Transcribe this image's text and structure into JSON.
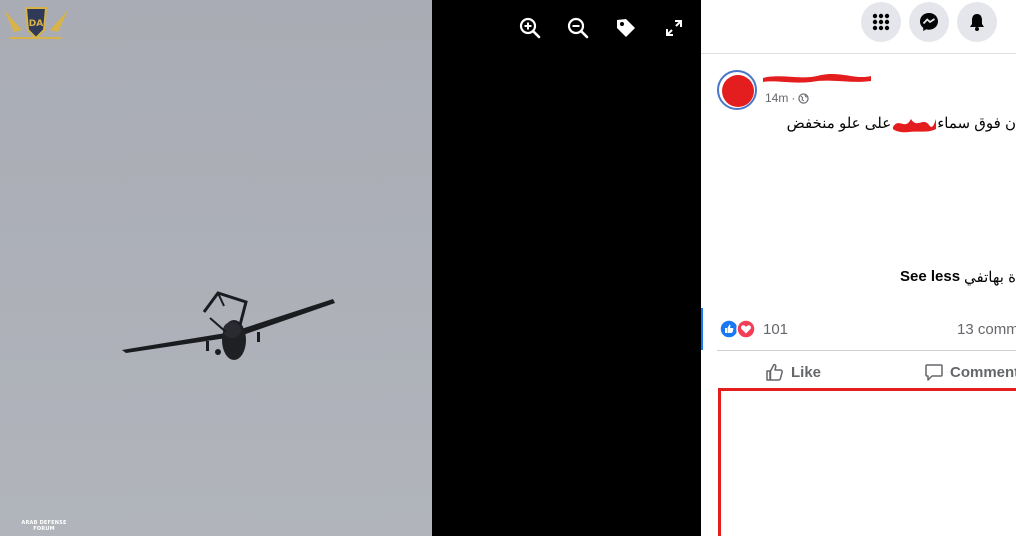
{
  "viewer": {
    "toolbar": [
      {
        "icon": "zoom-in-icon"
      },
      {
        "icon": "zoom-out-icon"
      },
      {
        "icon": "tag-icon"
      },
      {
        "icon": "fullscreen-icon"
      }
    ],
    "watermark_text": "ARAB DEFENSE FORUM",
    "watermark_logo": "DA"
  },
  "topbar": {
    "buttons": [
      {
        "icon": "menu-grid-icon"
      },
      {
        "icon": "messenger-icon"
      },
      {
        "icon": "notifications-bell-icon"
      }
    ]
  },
  "post": {
    "time": "14m",
    "privacy_icon": "globe-icon",
    "text_line1_part1": "ن فوق سماء",
    "text_line1_part2": "على علو منخفض",
    "text_line2": "ة بهاتفي",
    "see_less": "See less",
    "reaction_count": "101",
    "comment_count": "13 comm",
    "like_label": "Like",
    "comment_label": "Comment"
  },
  "colors": {
    "accent": "#1877f2",
    "redaction": "#e41e1e",
    "love": "#f33e58"
  }
}
